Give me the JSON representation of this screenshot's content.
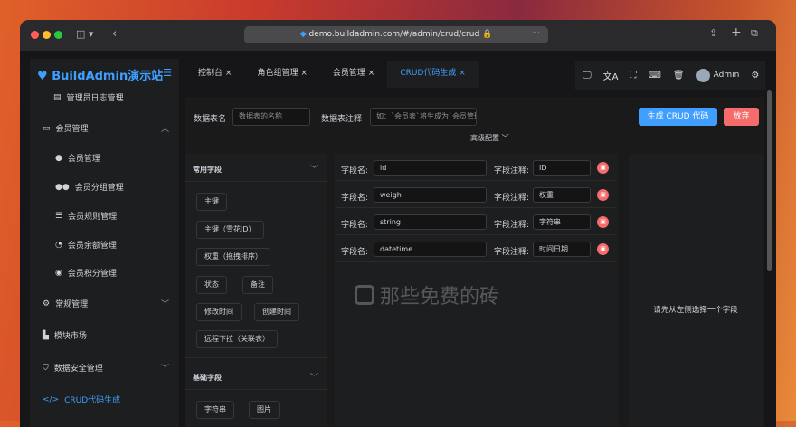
{
  "browser": {
    "url": "demo.buildadmin.com/#/admin/crud/crud"
  },
  "sidebar": {
    "logo": "BuildAdmin演示站",
    "items": [
      {
        "label": "管理员日志管理"
      },
      {
        "label": "会员管理"
      },
      {
        "label": "会员管理"
      },
      {
        "label": "会员分组管理"
      },
      {
        "label": "会员规则管理"
      },
      {
        "label": "会员余额管理"
      },
      {
        "label": "会员积分管理"
      },
      {
        "label": "常规管理"
      },
      {
        "label": "模块市场"
      },
      {
        "label": "数据安全管理"
      },
      {
        "label": "CRUD代码生成"
      }
    ]
  },
  "tabs": [
    "控制台",
    "角色组管理",
    "会员管理",
    "CRUD代码生成"
  ],
  "toolbar": {
    "user": "Admin"
  },
  "form": {
    "table_name_label": "数据表名",
    "table_name_placeholder": "数据表的名称",
    "table_comment_label": "数据表注释",
    "table_comment_placeholder": "如：`会员表`将生成为`会员管理`",
    "generate": "生成 CRUD 代码",
    "abandon": "放弃",
    "advanced": "高级配置"
  },
  "field_groups": [
    {
      "title": "常用字段",
      "tags": [
        "主键",
        "主键（雪花ID）",
        "权重（拖拽排序）",
        "状态",
        "备注",
        "修改时间",
        "创建时间",
        "远程下拉（关联表）"
      ]
    },
    {
      "title": "基础字段",
      "tags": [
        "字符串",
        "图片"
      ]
    }
  ],
  "fields": {
    "name_label": "字段名:",
    "comment_label": "字段注释:",
    "rows": [
      {
        "name": "id",
        "comment": "ID"
      },
      {
        "name": "weigh",
        "comment": "权重"
      },
      {
        "name": "string",
        "comment": "字符串"
      },
      {
        "name": "datetime",
        "comment": "时间日期"
      }
    ]
  },
  "detail_hint": "请先从左侧选择一个字段",
  "watermark": "那些免费的砖"
}
